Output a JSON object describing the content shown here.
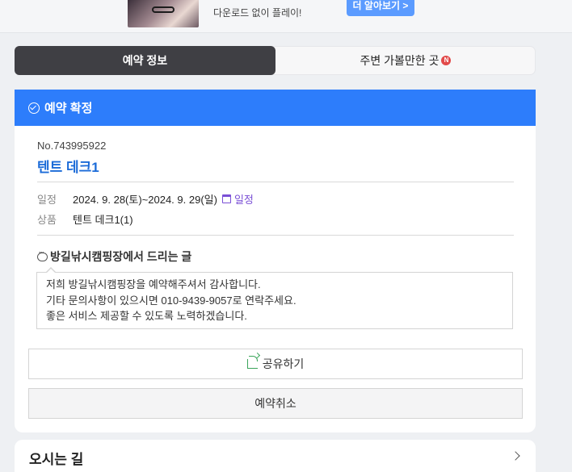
{
  "ad": {
    "text": "다운로드 없이 플레이!",
    "button_label": "더 알아보기 >"
  },
  "tabs": [
    {
      "label": "예약 정보",
      "active": true
    },
    {
      "label": "주변 가볼만한 곳",
      "badge": "N",
      "active": false
    }
  ],
  "status": {
    "label": "예약 확정",
    "color": "#2d7dfb"
  },
  "reservation": {
    "number": "No.743995922",
    "title": "텐트 데크1",
    "schedule_label": "일정",
    "schedule_value": "2024. 9. 28(토)~2024. 9. 29(일)",
    "calendar_link": "일정",
    "product_label": "상품",
    "product_value": "텐트 데크1(1)"
  },
  "message": {
    "heading": "방길낚시캠핑장에서 드리는 글",
    "lines": [
      "저희 방길낚시캠핑장을 예약해주셔서 감사합니다.",
      "기타 문의사항이 있으시면 010-9439-9057로 연락주세요.",
      "좋은 서비스 제공할 수 있도록 노력하겠습니다."
    ]
  },
  "buttons": {
    "share": "공유하기",
    "cancel": "예약취소"
  },
  "next_section": {
    "title": "오시는 길"
  }
}
